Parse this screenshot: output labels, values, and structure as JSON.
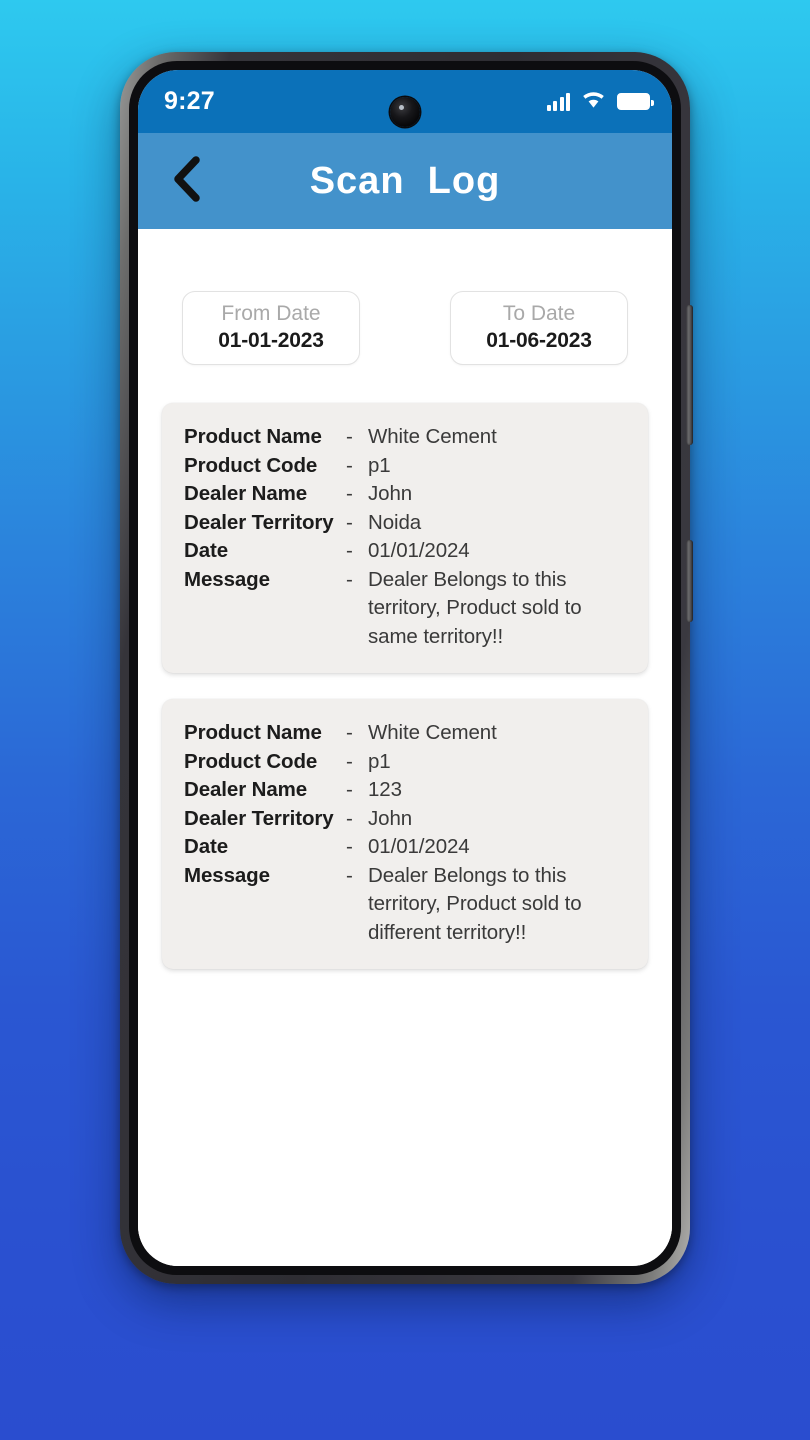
{
  "background": {
    "gradient_top": "#2ec9ef",
    "gradient_bottom": "#2a4dcf"
  },
  "device": {
    "frame_color": "#2e2d33",
    "camera_icon": "front-camera-punch-hole"
  },
  "status_bar": {
    "time": "9:27",
    "background_color": "#0b71b9",
    "icons": [
      {
        "name": "signal-icon",
        "bars": 4
      },
      {
        "name": "wifi-icon",
        "level": 3
      },
      {
        "name": "battery-icon",
        "state": "full"
      }
    ]
  },
  "app_bar": {
    "background_color": "#4392cb",
    "back_icon": "chevron-left-icon",
    "title": "Scan  Log"
  },
  "date_range": {
    "from": {
      "label": "From Date",
      "value": "01-01-2023",
      "placeholder": "From Date"
    },
    "to": {
      "label": "To Date",
      "value": "01-06-2023",
      "placeholder": "To Date"
    }
  },
  "separator": "-",
  "cards": [
    {
      "card_background": "#f1efed",
      "rows": [
        {
          "label": "Product Name",
          "value": "White Cement"
        },
        {
          "label": "Product Code",
          "value": "p1"
        },
        {
          "label": "Dealer Name",
          "value": "John"
        },
        {
          "label": "Dealer Territory",
          "value": "Noida"
        },
        {
          "label": "Date",
          "value": "01/01/2024"
        },
        {
          "label": "Message",
          "value": "Dealer Belongs to this territory, Product sold to same territory!!"
        }
      ]
    },
    {
      "card_background": "#f1efed",
      "rows": [
        {
          "label": "Product Name",
          "value": "White Cement"
        },
        {
          "label": "Product Code",
          "value": "p1"
        },
        {
          "label": "Dealer Name",
          "value": "123"
        },
        {
          "label": "Dealer Territory",
          "value": "John"
        },
        {
          "label": "Date",
          "value": "01/01/2024"
        },
        {
          "label": "Message",
          "value": "Dealer Belongs to this territory, Product sold to different territory!!"
        }
      ]
    }
  ]
}
